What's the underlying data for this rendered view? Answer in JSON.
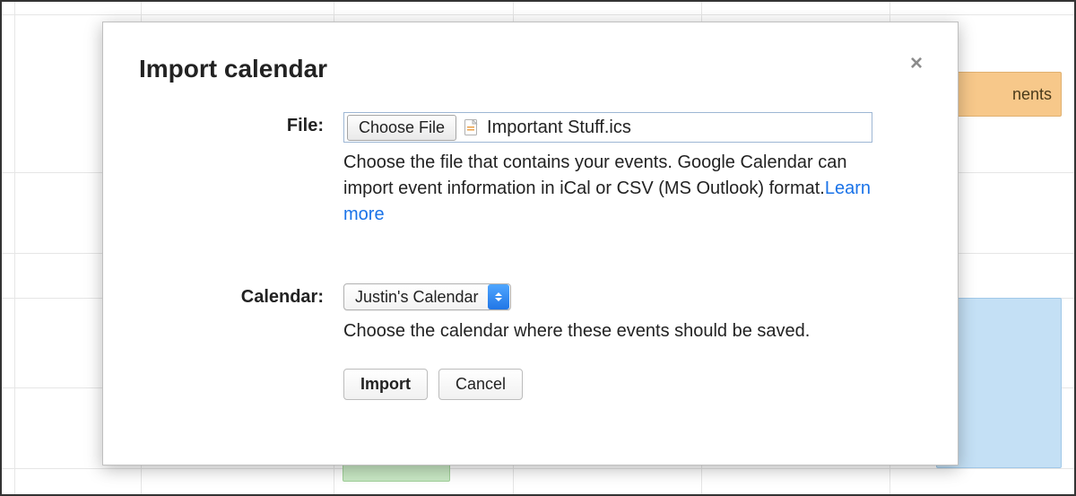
{
  "background": {
    "orange_event_text": "nents"
  },
  "dialog": {
    "title": "Import calendar",
    "close_label": "×",
    "file": {
      "label": "File:",
      "choose_button": "Choose File",
      "selected_filename": "Important Stuff.ics",
      "help_text": "Choose the file that contains your events. Google Calendar can import event information in iCal or CSV (MS Outlook) format.",
      "learn_more": "Learn more"
    },
    "calendar": {
      "label": "Calendar:",
      "selected": "Justin's Calendar",
      "help_text": "Choose the calendar where these events should be saved."
    },
    "buttons": {
      "import": "Import",
      "cancel": "Cancel"
    }
  }
}
